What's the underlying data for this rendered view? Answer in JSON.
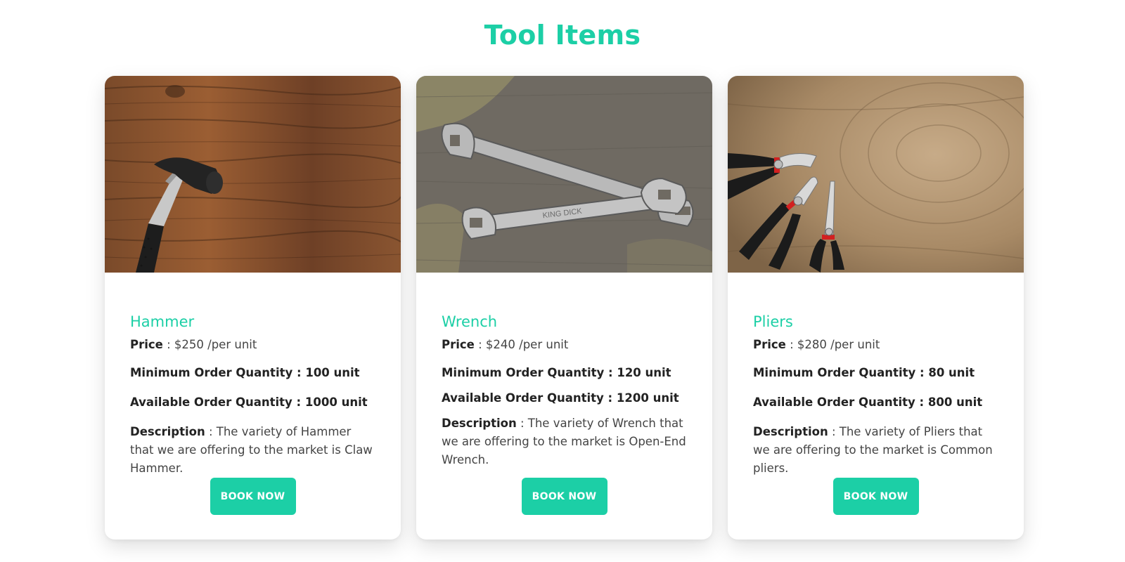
{
  "page": {
    "title": "Tool Items"
  },
  "labels": {
    "price": "Price",
    "min_qty": "Minimum Order Quantity :",
    "avail_qty": "Available Order Quantity :",
    "description": "Description"
  },
  "cards": [
    {
      "name": "Hammer",
      "price": " : $250 /per unit",
      "min_qty": "100 unit",
      "avail_qty": "1000 unit",
      "description": " : The variety of Hammer that we are offering to the market is Claw Hammer.",
      "button": "BOOK NOW",
      "image_icon": "hammer-image"
    },
    {
      "name": "Wrench",
      "price": " : $240 /per unit",
      "min_qty": "120 unit",
      "avail_qty": "1200 unit",
      "description": " : The variety of Wrench that we are offering to the market is Open-End Wrench.",
      "button": "BOOK NOW",
      "image_icon": "wrench-image"
    },
    {
      "name": "Pliers",
      "price": " : $280 /per unit",
      "min_qty": "80 unit",
      "avail_qty": "800 unit",
      "description": " : The variety of Pliers that we are offering to the market is Common pliers.",
      "button": "BOOK NOW",
      "image_icon": "pliers-image"
    }
  ],
  "colors": {
    "accent": "#1ccfa6"
  }
}
